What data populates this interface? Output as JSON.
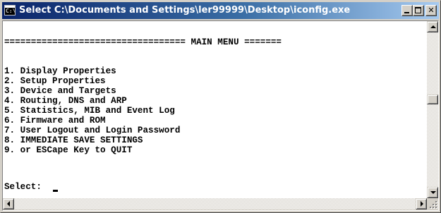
{
  "window": {
    "title": "Select C:\\Documents and Settings\\ler99999\\Desktop\\iconfig.exe",
    "icon": "console-window-icon",
    "icon_glyph": "C:\\",
    "buttons": {
      "minimize": "minimize-icon",
      "maximize": "maximize-icon",
      "close_glyph": "✕"
    }
  },
  "console": {
    "menu_rule": "================================== MAIN MENU =======",
    "items": [
      "1. Display Properties",
      "2. Setup Properties",
      "3. Device and Targets",
      "4. Routing, DNS and ARP",
      "5. Statistics, MIB and Event Log",
      "6. Firmware and ROM",
      "7. User Logout and Login Password",
      "8. IMMEDIATE SAVE SETTINGS",
      "9. or ESCape Key to QUIT"
    ],
    "prompt": "Select: ",
    "vertical_scroll_position": 0.43
  },
  "colors": {
    "titlebar_start": "#0a246a",
    "titlebar_end": "#a6caf0",
    "console_background": "#ffffff",
    "console_text": "#000000",
    "chrome": "#d4d0c8"
  }
}
